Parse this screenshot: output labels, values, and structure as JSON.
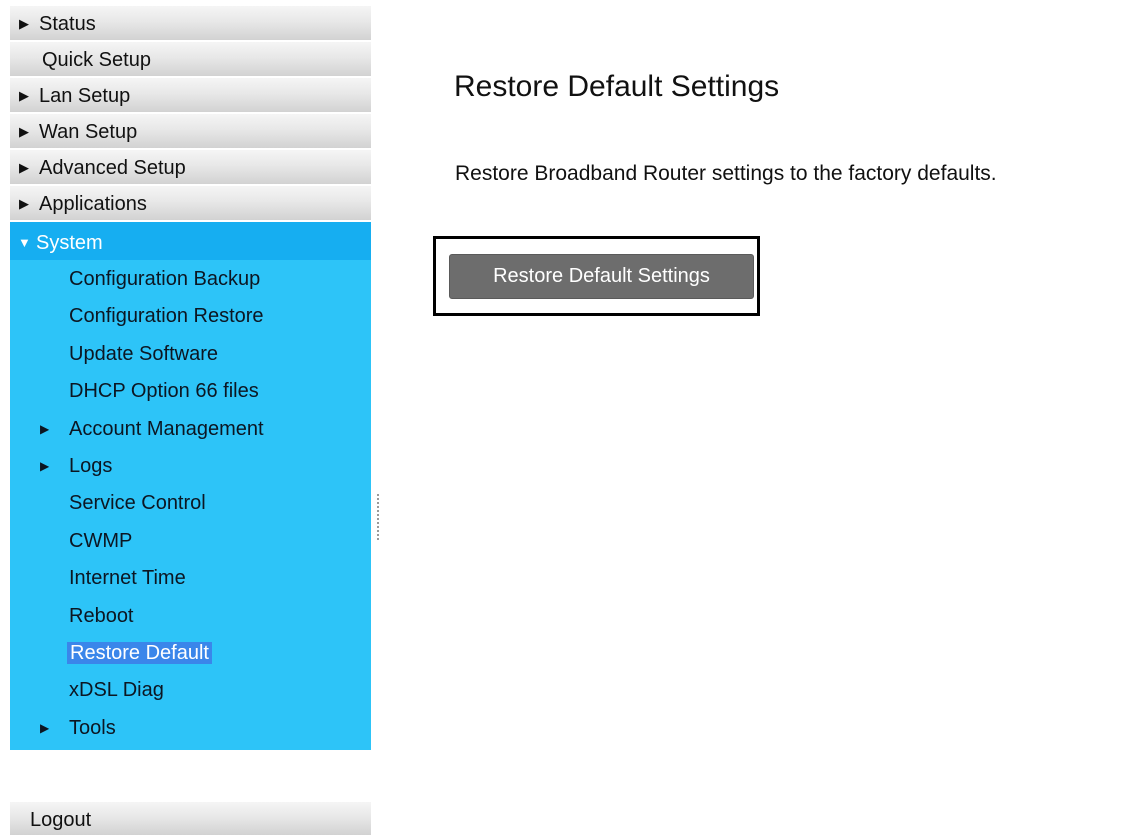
{
  "sidebar": {
    "status": "Status",
    "quick_setup": "Quick Setup",
    "lan_setup": "Lan Setup",
    "wan_setup": "Wan Setup",
    "advanced_setup": "Advanced Setup",
    "applications": "Applications",
    "system": {
      "label": "System",
      "items": {
        "config_backup": "Configuration Backup",
        "config_restore": "Configuration Restore",
        "update_software": "Update Software",
        "dhcp_option": "DHCP Option 66 files",
        "account_mgmt": "Account Management",
        "logs": "Logs",
        "service_control": "Service Control",
        "cwmp": "CWMP",
        "internet_time": "Internet Time",
        "reboot": "Reboot",
        "restore_default": "Restore Default",
        "xdsl_diag": "xDSL Diag",
        "tools": "Tools"
      }
    },
    "logout": "Logout"
  },
  "main": {
    "title": "Restore Default Settings",
    "description": "Restore Broadband Router settings to the factory defaults.",
    "button_label": "Restore Default Settings"
  },
  "icons": {
    "collapsed": "triangle-right-icon",
    "expanded": "triangle-down-icon",
    "divider": "dotted-resize-handle-icon"
  },
  "colors": {
    "sidebar_active": "#16aef1",
    "sidebar_submenu_bg": "#2dc4f8",
    "selected_highlight": "#3a86ea",
    "button_bg": "#6d6d6d"
  }
}
